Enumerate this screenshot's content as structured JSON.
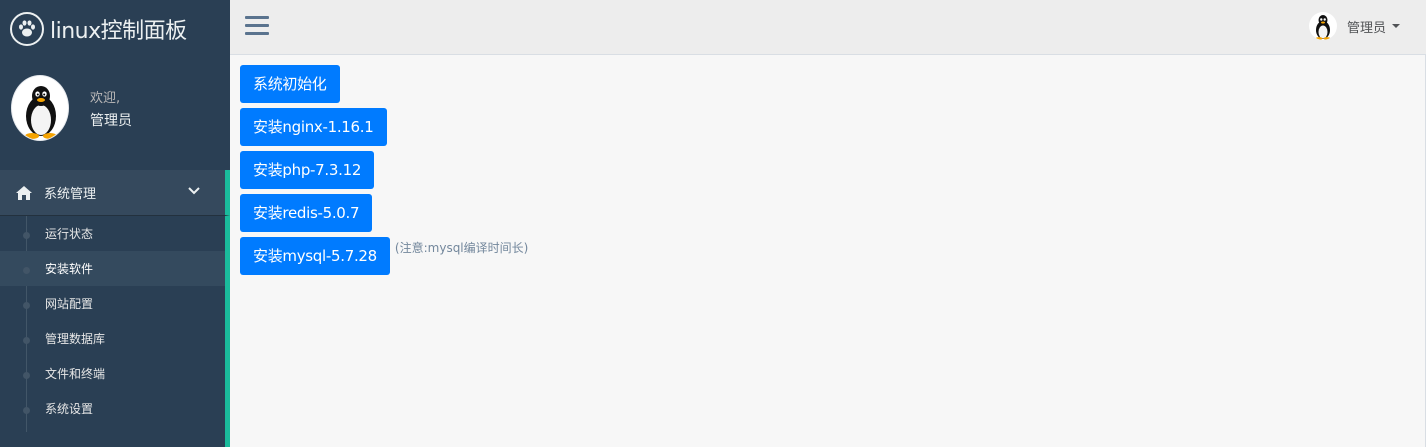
{
  "brand": {
    "title": "linux控制面板",
    "logo_icon": "paw-icon"
  },
  "profile": {
    "welcome": "欢迎,",
    "name": "管理员"
  },
  "menu": {
    "section_label": "系统管理",
    "items": [
      {
        "label": "运行状态"
      },
      {
        "label": "安装软件"
      },
      {
        "label": "网站配置"
      },
      {
        "label": "管理数据库"
      },
      {
        "label": "文件和终端"
      },
      {
        "label": "系统设置"
      }
    ]
  },
  "topnav": {
    "user_name": "管理员"
  },
  "actions": [
    {
      "label": "系统初始化"
    },
    {
      "label": "安装nginx-1.16.1"
    },
    {
      "label": "安装php-7.3.12"
    },
    {
      "label": "安装redis-5.0.7"
    },
    {
      "label": "安装mysql-5.7.28",
      "note": "(注意:mysql编译时间长)"
    }
  ],
  "colors": {
    "sidebar": "#2a3f54",
    "accent": "#1abb9c",
    "button": "#007bff"
  }
}
